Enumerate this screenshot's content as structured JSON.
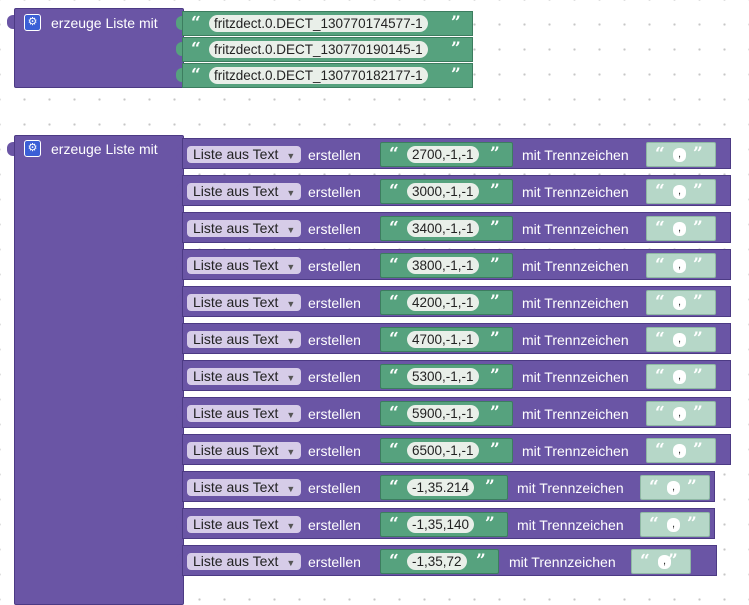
{
  "colors": {
    "list_block": "#6a55a5",
    "text_block": "#56a27e",
    "separator_block": "#b6d7c8",
    "mutator_icon": "#3b5fd6"
  },
  "icons": {
    "mutator": "gear-icon",
    "open_quote": "“",
    "close_quote": "”"
  },
  "block1": {
    "label": "erzeuge Liste mit",
    "items": [
      "fritzdect.0.DECT_130770174577-1",
      "fritzdect.0.DECT_130770190145-1",
      "fritzdect.0.DECT_130770182177-1"
    ]
  },
  "block2": {
    "label": "erzeuge Liste mit",
    "dropdown_label": "Liste aus Text",
    "create_label": "erstellen",
    "separator_label": "mit Trennzeichen",
    "separator_value": ",",
    "rows": [
      {
        "text": "2700,-1,-1"
      },
      {
        "text": "3000,-1,-1"
      },
      {
        "text": "3400,-1,-1"
      },
      {
        "text": "3800,-1,-1"
      },
      {
        "text": "4200,-1,-1"
      },
      {
        "text": "4700,-1,-1"
      },
      {
        "text": "5300,-1,-1"
      },
      {
        "text": "5900,-1,-1"
      },
      {
        "text": "6500,-1,-1"
      },
      {
        "text": "-1,35.214"
      },
      {
        "text": "-1,35,140"
      },
      {
        "text": "-1,35,72"
      }
    ]
  }
}
